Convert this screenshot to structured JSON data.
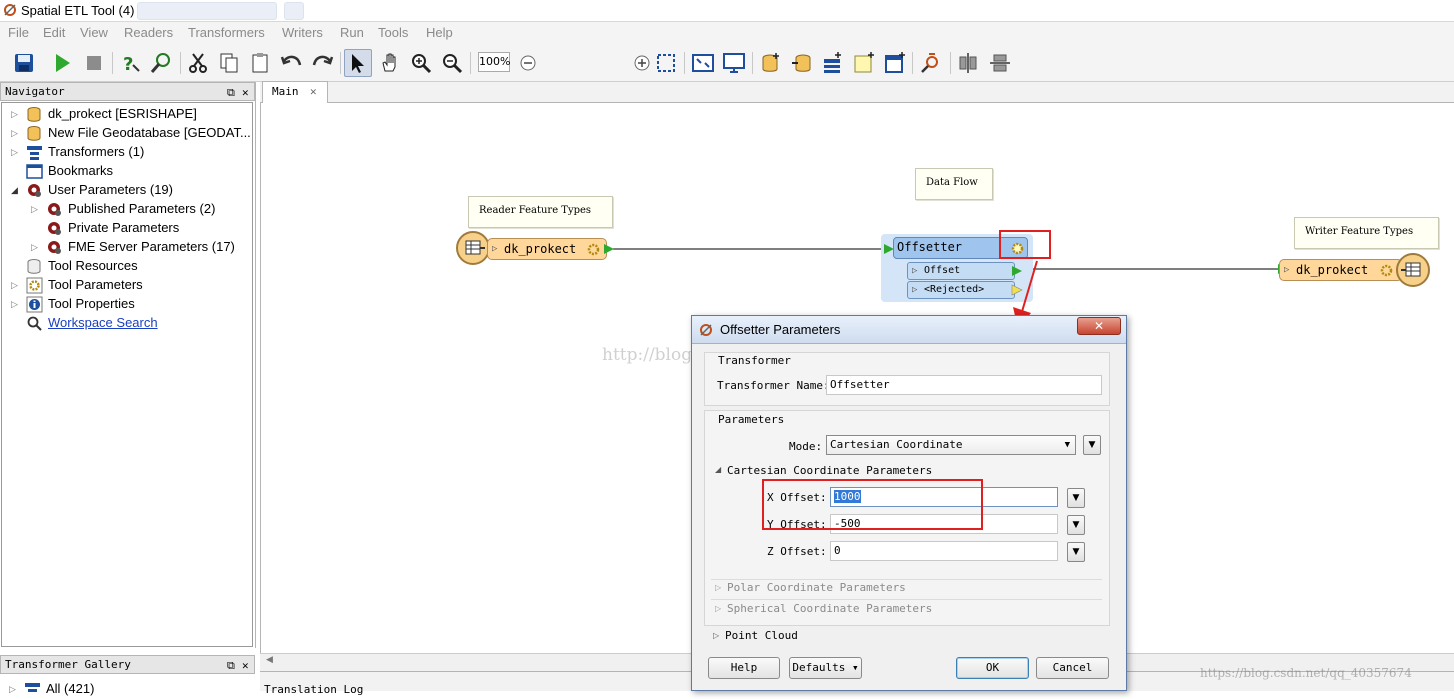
{
  "window": {
    "title": "Spatial ETL Tool (4)"
  },
  "menu": [
    "File",
    "Edit",
    "View",
    "Readers",
    "Transformers",
    "Writers",
    "Run",
    "Tools",
    "Help"
  ],
  "toolbar": {
    "zoom_level": "100%",
    "buttons": [
      "save-icon",
      "run-icon",
      "stop-icon",
      "help-icon",
      "find-icon",
      "cut-icon",
      "copy-icon",
      "paste-icon",
      "undo-icon",
      "redo-icon",
      "select-icon",
      "pan-icon",
      "zoom-in-icon",
      "zoom-out-icon"
    ]
  },
  "navigator": {
    "title": "Navigator",
    "items": [
      {
        "label": "dk_prokect [ESRISHAPE]",
        "icon": "reader-icon"
      },
      {
        "label": "New File Geodatabase [GEODAT...",
        "icon": "writer-icon"
      },
      {
        "label": "Transformers (1)",
        "icon": "transformers-icon"
      },
      {
        "label": "Bookmarks",
        "icon": "bookmark-icon"
      },
      {
        "label": "User Parameters (19)",
        "icon": "parameters-icon"
      },
      {
        "label": "Published Parameters (2)",
        "icon": "parameters-icon"
      },
      {
        "label": "Private Parameters",
        "icon": "parameters-icon"
      },
      {
        "label": "FME Server Parameters (17)",
        "icon": "parameters-icon"
      },
      {
        "label": "Tool Resources",
        "icon": "resources-icon"
      },
      {
        "label": "Tool Parameters",
        "icon": "gear-icon"
      },
      {
        "label": "Tool Properties",
        "icon": "info-icon"
      },
      {
        "label": "Workspace Search",
        "icon": "search-icon"
      }
    ]
  },
  "gallery": {
    "title": "Transformer Gallery",
    "first_item": "All (421)"
  },
  "tabs": {
    "main": "Main",
    "log": "Translation Log"
  },
  "canvas": {
    "notes": {
      "reader": "Reader Feature Types",
      "flow": "Data Flow",
      "writer": "Writer Feature Types"
    },
    "reader_name": "dk_prokect",
    "transformer_name": "Offsetter",
    "ports": [
      "Offset",
      "<Rejected>"
    ],
    "writer_name": "dk_prokect"
  },
  "dialog": {
    "title": "Offsetter Parameters",
    "close": "✕",
    "transformer_group": "Transformer",
    "transformer_name_label": "Transformer Name:",
    "transformer_name_value": "Offsetter",
    "parameters_group": "Parameters",
    "mode_label": "Mode:",
    "mode_value": "Cartesian Coordinate",
    "cartesian_group": "Cartesian Coordinate Parameters",
    "x_label": "X Offset:",
    "x_value": "1000",
    "y_label": "Y Offset:",
    "y_value": "-500",
    "z_label": "Z Offset:",
    "z_value": "0",
    "polar_group": "Polar Coordinate Parameters",
    "spherical_group": "Spherical Coordinate Parameters",
    "point_cloud_group": "Point Cloud",
    "help": "Help",
    "defaults": "Defaults ▾",
    "ok": "OK",
    "cancel": "Cancel"
  },
  "watermarks": {
    "center": "http://blog.csdn.net/zglybl",
    "corner": "https://blog.csdn.net/qq_40357674"
  },
  "colors": {
    "feature_type": "#ffd79a",
    "transformer": "#9fc4ee",
    "highlight": "#e02020",
    "connector": "#2fa82f"
  }
}
